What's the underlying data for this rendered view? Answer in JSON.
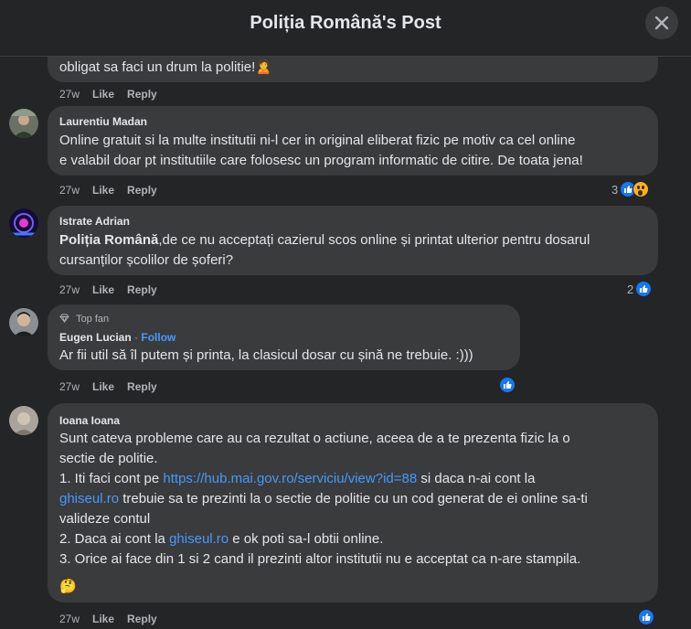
{
  "header": {
    "title": "Poliția Română's Post"
  },
  "comments": [
    {
      "text_lines": [
        "obligat sa faci un drum la politie!🙎"
      ],
      "time": "27w",
      "like": "Like",
      "reply": "Reply"
    },
    {
      "author": "Laurentiu Madan",
      "text_lines": [
        "Online gratuit si la multe institutii ni-l cer in original eliberat fizic pe motiv ca cel online",
        "e valabil doar pt institutiile care folosesc un program informatic de citire. De toata jena!"
      ],
      "time": "27w",
      "like": "Like",
      "reply": "Reply",
      "reaction_count": "3"
    },
    {
      "author": "Istrate Adrian",
      "mention": "Poliția Română",
      "text_line1_rest": ",de ce nu acceptați cazierul scos online și printat ulterior pentru dosarul",
      "text_line2": "cursanților școlilor de șoferi?",
      "time": "27w",
      "like": "Like",
      "reply": "Reply",
      "reaction_count": "2"
    },
    {
      "badge": "Top fan",
      "author": "Eugen Lucian",
      "follow": "Follow",
      "sep": " · ",
      "text_lines": [
        "Ar fii util să îl putem și printa, la clasicul dosar cu șină ne trebuie. :)))"
      ],
      "time": "27w",
      "like": "Like",
      "reply": "Reply"
    },
    {
      "author": "Ioana Ioana",
      "line1": "Sunt cateva probleme care au ca rezultat o actiune, aceea de a te prezenta fizic la o",
      "line2": "sectie de politie.",
      "line3_a": "1. Iti faci cont pe ",
      "line3_link": "https://hub.mai.gov.ro/serviciu/view?id=88",
      "line3_b": " si daca n-ai cont la",
      "line4_link": "ghiseul.ro",
      "line4_b": " trebuie sa te prezinti la o sectie de politie cu un cod generat de ei online sa-ti",
      "line5": "valideze contul",
      "line6_a": "2. Daca ai cont la ",
      "line6_link": "ghiseul.ro",
      "line6_b": " e ok poti sa-l obtii online.",
      "line7": "3. Orice ai face din 1 si 2 cand il prezinti altor institutii nu e acceptat ca n-are stampila.",
      "emoji": "🤔",
      "time": "27w",
      "like": "Like",
      "reply": "Reply"
    }
  ]
}
